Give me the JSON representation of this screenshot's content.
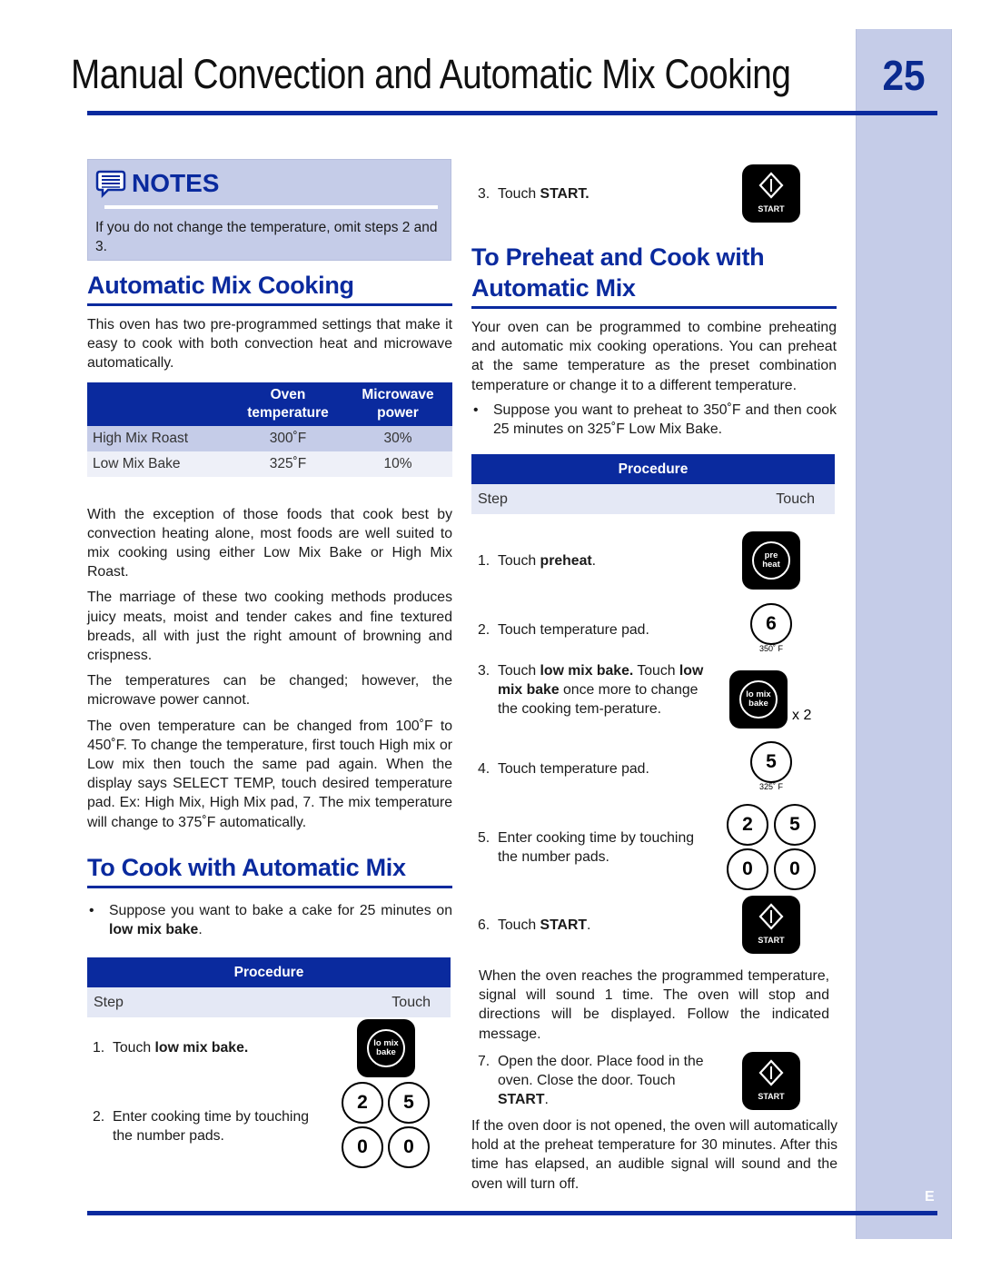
{
  "page": {
    "title": "Manual Convection and Automatic Mix Cooking",
    "number": "25",
    "language_mark": "E"
  },
  "notes": {
    "title": "NOTES",
    "text": "If you do not change the temperature, omit steps 2 and 3."
  },
  "automatic_mix": {
    "heading": "Automatic Mix Cooking",
    "intro": "This oven has two pre-programmed settings that make it easy to cook with both convection heat and microwave automatically.",
    "table": {
      "headers": [
        "",
        "Oven temperature",
        "Microwave power"
      ],
      "header_lines": [
        [
          "",
          ""
        ],
        [
          "Oven",
          "temperature"
        ],
        [
          "Microwave",
          "power"
        ]
      ],
      "rows": [
        {
          "setting": "High Mix Roast",
          "oven_temperature": "300˚F",
          "microwave_power": "30%"
        },
        {
          "setting": "Low Mix Bake",
          "oven_temperature": "325˚F",
          "microwave_power": "10%"
        }
      ]
    },
    "paragraphs": [
      "With the exception of those foods that cook best by convection heating alone, most foods are well suited to mix cooking using either Low Mix Bake or High Mix Roast.",
      "The marriage of these two cooking methods produces juicy meats, moist and tender cakes and fine textured breads, all with just the right amount of browning and crispness.",
      "The temperatures can be changed; however, the microwave power cannot.",
      "The oven temperature can be changed from 100˚F to 450˚F. To change the temperature, first touch High mix or Low mix then touch the same pad again. When the display says SELECT TEMP, touch desired temperature pad. Ex: High Mix, High Mix pad, 7. The mix temperature will change to 375˚F automatically."
    ]
  },
  "cook_with_mix": {
    "heading": "To Cook with Automatic Mix",
    "bullet": {
      "prefix": "Suppose you want to bake a cake for 25 minutes on ",
      "bold": "low mix bake",
      "suffix": "."
    },
    "procedure": {
      "title": "Procedure",
      "col_step": "Step",
      "col_touch": "Touch",
      "steps": [
        {
          "num": "1.",
          "text": "Touch ",
          "bold": "low mix bake.",
          "after": ""
        },
        {
          "num": "2.",
          "text": "Enter cooking time by touching the number pads.",
          "bold": "",
          "after": ""
        },
        {
          "num": "3.",
          "text": "Touch ",
          "bold": "START.",
          "after": ""
        }
      ],
      "pads": {
        "lomix_line1": "lo mix",
        "lomix_line2": "bake",
        "digits": [
          "2",
          "5",
          "0",
          "0"
        ],
        "start_label": "START"
      }
    }
  },
  "preheat_mix": {
    "heading": "To Preheat and Cook with Automatic Mix",
    "heading_lines": [
      "To Preheat and Cook with",
      "Automatic Mix"
    ],
    "intro": "Your oven can be programmed to combine preheating and automatic mix cooking operations. You can preheat at the same temperature as the preset combination temperature or change it to a different temperature.",
    "bullet": "Suppose you want to preheat to 350˚F and then cook 25 minutes on 325˚F Low Mix Bake.",
    "procedure": {
      "title": "Procedure",
      "col_step": "Step",
      "col_touch": "Touch",
      "steps": [
        {
          "num": "1.",
          "text": "Touch ",
          "bold": "preheat",
          "after": "."
        },
        {
          "num": "2.",
          "text": "Touch temperature pad.",
          "bold": "",
          "after": ""
        },
        {
          "num": "3.",
          "parts": [
            "Touch ",
            "low mix bake.",
            " Touch ",
            "low mix bake",
            " once more to change the cooking tem-perature."
          ]
        },
        {
          "num": "4.",
          "text": "Touch temperature pad.",
          "bold": "",
          "after": ""
        },
        {
          "num": "5.",
          "text": "Enter cooking time by touching the number pads.",
          "bold": "",
          "after": ""
        },
        {
          "num": "6.",
          "text": "Touch ",
          "bold": "START",
          "after": "."
        },
        {
          "num": "7.",
          "text": "Open the door. Place food in the oven. Close the door. Touch ",
          "bold": "START",
          "after": "."
        }
      ],
      "pads": {
        "preheat_line1": "pre",
        "preheat_line2": "heat",
        "temp_pad_1": {
          "digit": "6",
          "caption": "350˚ F"
        },
        "lomix_line1": "lo mix",
        "lomix_line2": "bake",
        "lomix_repeat": "x 2",
        "temp_pad_2": {
          "digit": "5",
          "caption": "325˚ F"
        },
        "digits": [
          "2",
          "5",
          "0",
          "0"
        ],
        "start_label": "START"
      },
      "signal_note": "When the oven reaches the programmed temperature, signal will sound 1 time. The oven will stop and directions will be displayed. Follow the indicated message.",
      "hold_note": "If the oven door is not opened, the oven will automatically hold at the preheat temperature for 30 minutes. After this time has elapsed, an audible signal will sound and the oven will turn off."
    }
  }
}
